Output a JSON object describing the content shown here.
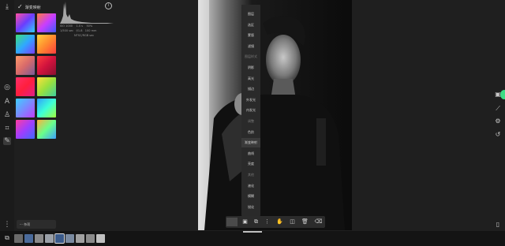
{
  "panel": {
    "title": "渐变映射",
    "confirm_icon": "check-icon",
    "info_icon": "info-icon"
  },
  "histogram": {
    "row1": [
      "ISO 1000",
      "1.0 s",
      "50%"
    ],
    "row2": [
      "1/500 sec",
      "f/1.8",
      "100 mm"
    ],
    "row3": "NTSC/RGB sec"
  },
  "menu": {
    "items": [
      {
        "label": "图层",
        "type": "item"
      },
      {
        "label": "选区",
        "type": "item"
      },
      {
        "label": "蒙版",
        "type": "item"
      },
      {
        "label": "滤镜",
        "type": "item"
      },
      {
        "label": "图层样式",
        "type": "section"
      },
      {
        "label": "阴影",
        "type": "item"
      },
      {
        "label": "高光",
        "type": "item"
      },
      {
        "label": "描边",
        "type": "item"
      },
      {
        "label": "外发光",
        "type": "item"
      },
      {
        "label": "内发光",
        "type": "item"
      },
      {
        "label": "调整",
        "type": "section"
      },
      {
        "label": "色阶",
        "type": "item"
      },
      {
        "label": "渐变映射",
        "type": "item",
        "selected": true
      },
      {
        "label": "曲线",
        "type": "item"
      },
      {
        "label": "亮度",
        "type": "item"
      },
      {
        "label": "其他",
        "type": "section"
      },
      {
        "label": "液化",
        "type": "item"
      },
      {
        "label": "模糊",
        "type": "item"
      },
      {
        "label": "锐化",
        "type": "item"
      }
    ]
  },
  "bottom_bar": {
    "chip_label": "···  杂项"
  },
  "colors": {
    "accent": "#3ddc84",
    "panel": "#2a2a2a",
    "background": "#1f1f1f"
  }
}
